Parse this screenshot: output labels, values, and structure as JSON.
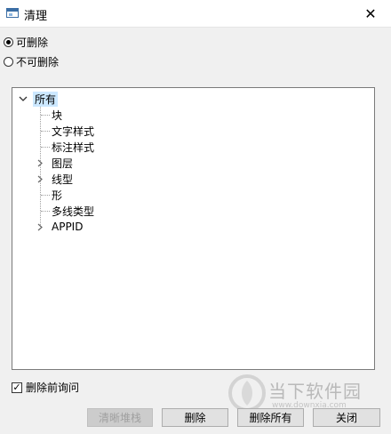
{
  "window": {
    "title": "清理",
    "close_glyph": "✕"
  },
  "options": {
    "deletable_label": "可删除",
    "nondeletable_label": "不可删除",
    "selected": "deletable"
  },
  "tree": {
    "root": "所有",
    "items": [
      {
        "label": "块",
        "expandable": false
      },
      {
        "label": "文字样式",
        "expandable": false
      },
      {
        "label": "标注样式",
        "expandable": false
      },
      {
        "label": "图层",
        "expandable": true
      },
      {
        "label": "线型",
        "expandable": true
      },
      {
        "label": "形",
        "expandable": false
      },
      {
        "label": "多线类型",
        "expandable": false
      },
      {
        "label": "APPID",
        "expandable": true
      }
    ]
  },
  "confirm_checkbox": {
    "label": "删除前询问",
    "checked": true
  },
  "buttons": {
    "purge_stack": "清晰堆栈",
    "delete": "删除",
    "delete_all": "删除所有",
    "close": "关闭"
  },
  "watermark": {
    "brand": "当下软件园",
    "url": "www.downxia.com"
  }
}
